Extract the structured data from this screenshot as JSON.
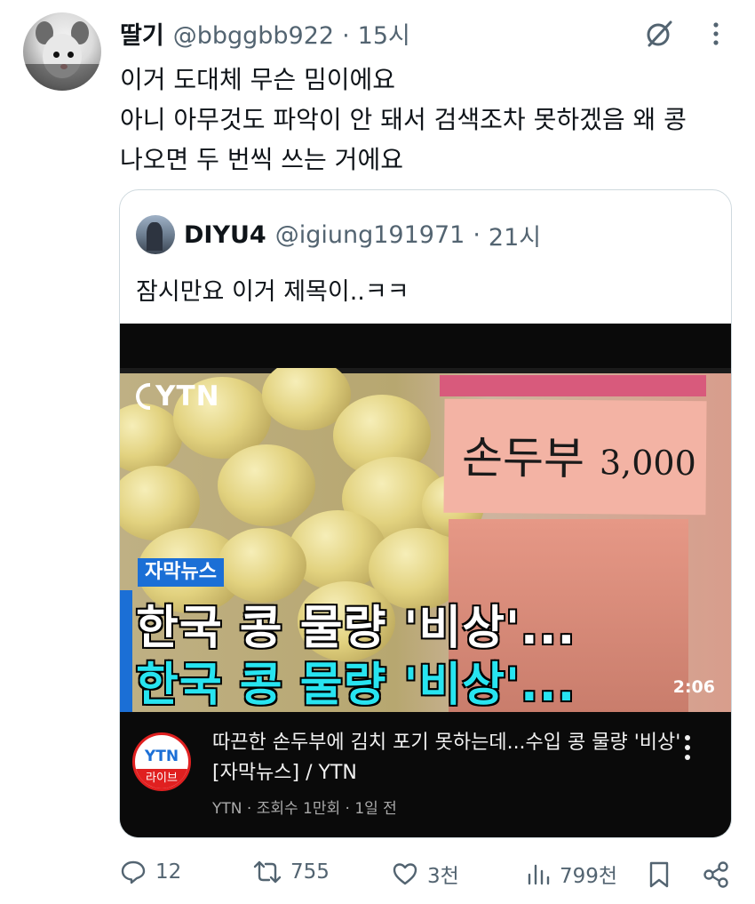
{
  "tweet": {
    "display_name": "딸기",
    "handle": "@bbggbb922",
    "separator": "·",
    "time": "15시",
    "lines": [
      "이거 도대체 무슨 밈이에요",
      "아니 아무것도 파악이 안 돼서 검색조차 못하겠음 왜 콩",
      "나오면 두 번씩 쓰는 거에요"
    ]
  },
  "quote": {
    "display_name": "DIYU4",
    "handle": "@igiung191971",
    "separator": "·",
    "time": "21시",
    "text": "잠시만요 이거 제목이..ㅋㅋ"
  },
  "video": {
    "logo": "YTN",
    "sign_text": "손두부",
    "sign_price": "3,000",
    "caption_tag": "자막뉴스",
    "headline_1": "한국 콩 물량 '비상'...",
    "headline_2": "한국 콩 물량 '비상'...",
    "duration": "2:06",
    "channel_logo": "YTN",
    "channel_live": "라이브",
    "title": "따끈한 손두부에 김치 포기 못하는데...수입 콩 물량 '비상' [자막뉴스] / YTN",
    "meta": "YTN · 조회수 1만회 · 1일 전"
  },
  "actions": {
    "replies": "12",
    "reposts": "755",
    "likes": "3천",
    "views": "799천"
  },
  "colors": {
    "text_primary": "#0f1419",
    "text_secondary": "#536471",
    "border": "#cfd9de",
    "ytn_blue": "#1b6fd6",
    "headline_cyan": "#27e4f0"
  },
  "icons": [
    "grok-icon",
    "more-icon",
    "reply-icon",
    "repost-icon",
    "like-icon",
    "views-icon",
    "bookmark-icon",
    "share-icon"
  ]
}
